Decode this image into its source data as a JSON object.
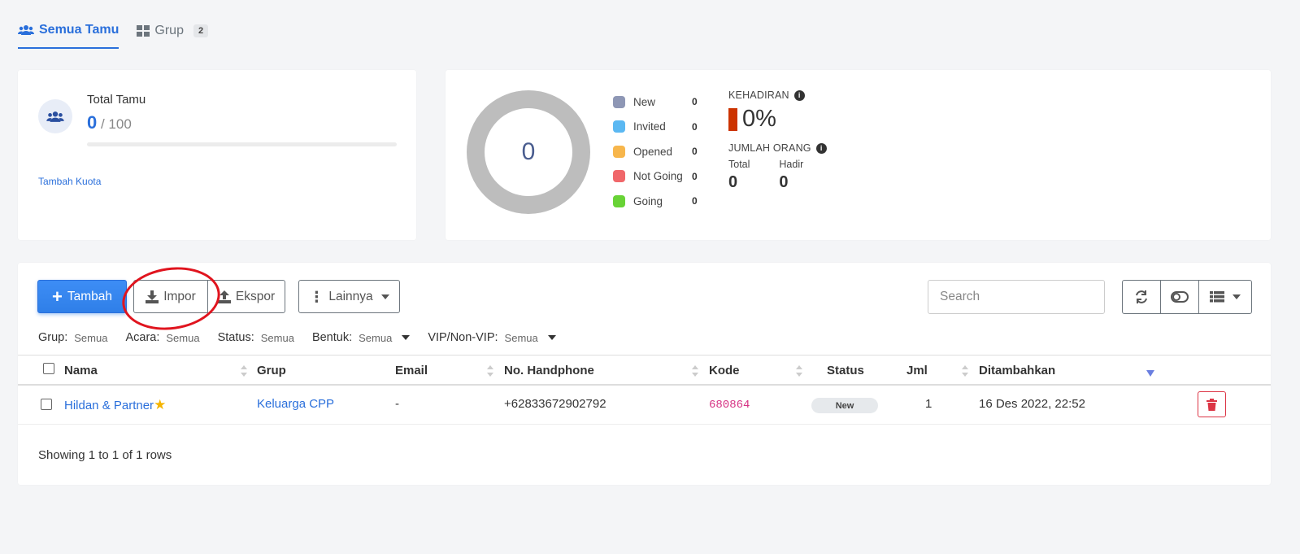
{
  "tabs": [
    {
      "label": "Semua Tamu",
      "active": true
    },
    {
      "label": "Grup",
      "badge": "2",
      "active": false
    }
  ],
  "quota": {
    "title": "Total Tamu",
    "used": "0",
    "total": "/ 100",
    "progress_fraction": 0,
    "link": "Tambah Kuota"
  },
  "stats": {
    "donut_value": "0",
    "legend": [
      {
        "label": "New",
        "value": "0",
        "color": "#8e97b5"
      },
      {
        "label": "Invited",
        "value": "0",
        "color": "#5bb8f2"
      },
      {
        "label": "Opened",
        "value": "0",
        "color": "#f7b64c"
      },
      {
        "label": "Not Going",
        "value": "0",
        "color": "#f0676a"
      },
      {
        "label": "Going",
        "value": "0",
        "color": "#68d336"
      }
    ],
    "attendance_title": "KEHADIRAN",
    "attendance_pct": "0%",
    "people_title": "JUMLAH ORANG",
    "people_total_label": "Total",
    "people_total_value": "0",
    "people_present_label": "Hadir",
    "people_present_value": "0"
  },
  "toolbar": {
    "add_label": "Tambah",
    "import_label": "Impor",
    "export_label": "Ekspor",
    "more_label": "Lainnya",
    "search_placeholder": "Search"
  },
  "filters": [
    {
      "label": "Grup:",
      "value": "Semua",
      "dropdown": false
    },
    {
      "label": "Acara:",
      "value": "Semua",
      "dropdown": false
    },
    {
      "label": "Status:",
      "value": "Semua",
      "dropdown": false
    },
    {
      "label": "Bentuk:",
      "value": "Semua",
      "dropdown": true
    },
    {
      "label": "VIP/Non-VIP:",
      "value": "Semua",
      "dropdown": true
    }
  ],
  "table": {
    "columns": [
      "Nama",
      "Grup",
      "Email",
      "No. Handphone",
      "Kode",
      "Status",
      "Jml",
      "Ditambahkan"
    ],
    "rows": [
      {
        "name": "Hildan & Partner",
        "group": "Keluarga CPP",
        "email": "-",
        "phone": "+62833672902792",
        "code": "680864",
        "status": "New",
        "count": "1",
        "added": "16 Des 2022, 22:52"
      }
    ],
    "info": "Showing 1 to 1 of 1 rows"
  },
  "colors": {
    "accent": "#2a6fdb",
    "danger": "#dc3545",
    "donut_empty": "#bdbdbd",
    "annotation": "#e0141e"
  }
}
